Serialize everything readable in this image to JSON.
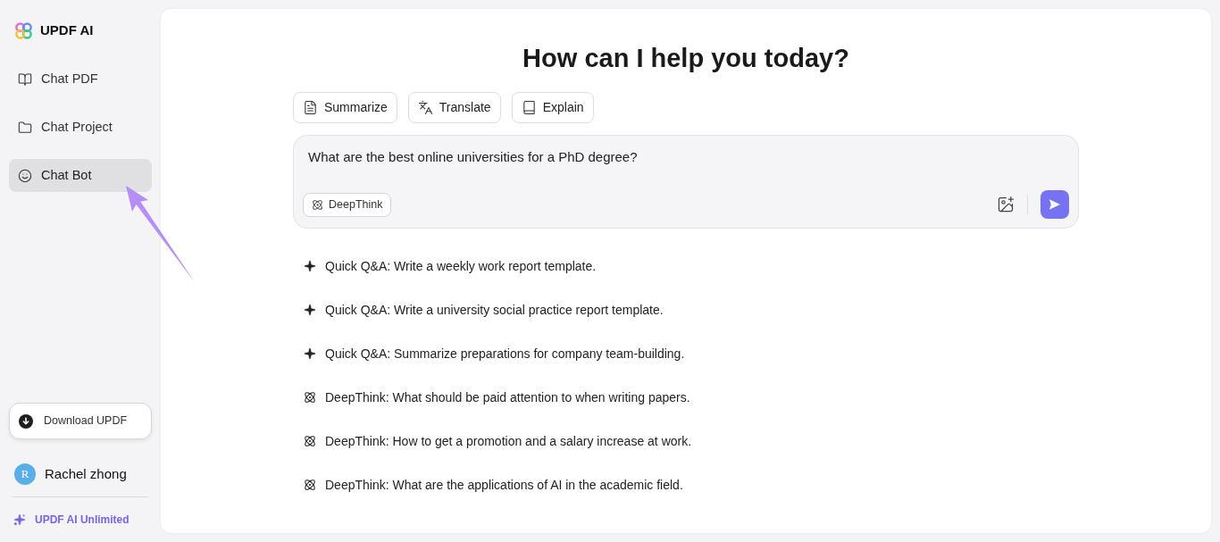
{
  "sidebar": {
    "brand": "UPDF AI",
    "nav": [
      {
        "label": "Chat PDF",
        "kind": "pdf",
        "selected": false
      },
      {
        "label": "Chat Project",
        "kind": "project",
        "selected": false
      },
      {
        "label": "Chat Bot",
        "kind": "bot",
        "selected": true
      }
    ],
    "download_button": "Download UPDF",
    "user": {
      "initial": "R",
      "name": "Rachel zhong"
    },
    "plan_link": "UPDF AI Unlimited"
  },
  "main": {
    "heading": "How can I help you today?",
    "actions": [
      {
        "label": "Summarize",
        "kind": "summarize"
      },
      {
        "label": "Translate",
        "kind": "translate"
      },
      {
        "label": "Explain",
        "kind": "explain"
      }
    ],
    "prompt": {
      "value": "What are the best online universities for a PhD degree?",
      "mode_button": "DeepThink"
    },
    "suggestions": [
      {
        "kind": "quick",
        "text": "Quick Q&A: Write a weekly work report template."
      },
      {
        "kind": "quick",
        "text": "Quick Q&A: Write a university social practice report template."
      },
      {
        "kind": "quick",
        "text": "Quick Q&A: Summarize preparations for company team-building."
      },
      {
        "kind": "deepthink",
        "text": "DeepThink: What should be paid attention to when writing papers."
      },
      {
        "kind": "deepthink",
        "text": "DeepThink: How to get a promotion and a salary increase at work."
      },
      {
        "kind": "deepthink",
        "text": "DeepThink: What are the applications of AI in the academic field."
      }
    ]
  }
}
